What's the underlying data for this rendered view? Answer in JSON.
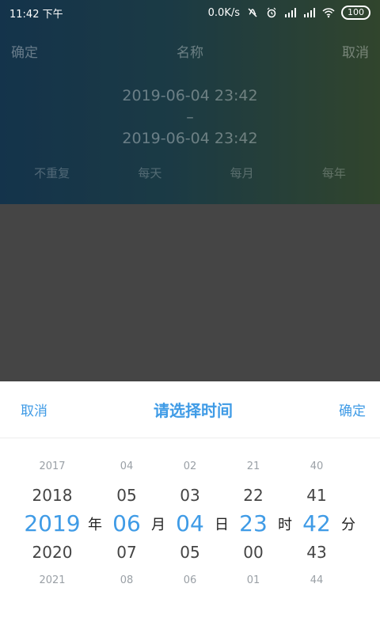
{
  "status": {
    "time": "11:42 下午",
    "net_speed": "0.0K/s",
    "battery": "100"
  },
  "top": {
    "confirm": "确定",
    "title": "名称",
    "cancel": "取消",
    "range_start": "2019-06-04 23:42",
    "range_sep": "–",
    "range_end": "2019-06-04 23:42",
    "repeat": [
      "不重复",
      "每天",
      "每月",
      "每年"
    ]
  },
  "sheet": {
    "cancel": "取消",
    "title": "请选择时间",
    "confirm": "确定"
  },
  "picker": {
    "year": [
      "2017",
      "2018",
      "2019",
      "2020",
      "2021"
    ],
    "month": [
      "04",
      "05",
      "06",
      "07",
      "08"
    ],
    "day": [
      "02",
      "03",
      "04",
      "05",
      "06"
    ],
    "hour": [
      "21",
      "22",
      "23",
      "00",
      "01"
    ],
    "minute": [
      "40",
      "41",
      "42",
      "43",
      "44"
    ],
    "units": [
      "年",
      "月",
      "日",
      "时",
      "分"
    ]
  },
  "colors": {
    "accent": "#3f9be6"
  },
  "icons": [
    "mute-icon",
    "alarm-icon",
    "signal-icon",
    "signal-icon",
    "wifi-icon",
    "battery-icon"
  ]
}
